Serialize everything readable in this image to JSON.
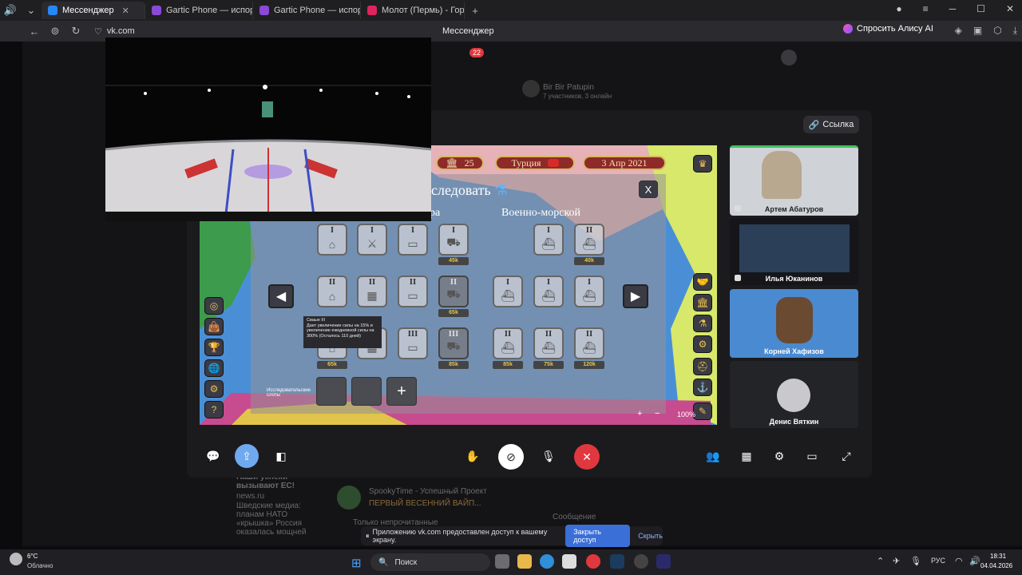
{
  "browser": {
    "tabs": [
      {
        "title": "Мессенджер",
        "active": true,
        "color": "#2787f5"
      },
      {
        "title": "Gartic Phone — испорчен",
        "active": false,
        "color": "#8a49d6"
      },
      {
        "title": "Gartic Phone — испорчен",
        "active": false,
        "color": "#8a49d6"
      },
      {
        "title": "Молот (Пермь) - Гор",
        "active": false,
        "color": "#e0245e"
      }
    ],
    "url": "vk.com",
    "page_title": "Мессенджер",
    "alice_label": "Спросить Алису AI"
  },
  "background": {
    "chat_name": "Bir Bir Patupin",
    "chat_meta": "7 участников, 3 онлайн",
    "badge_count": "22",
    "left_snippet_title": "Наши успехи вызывают ЕС!",
    "left_snippet_source": "news.ru",
    "left_snippet_text": "Шведские медиа: планам НАТО «крышка» Россия оказалась мощней",
    "list_item_title": "SpookyTime - Успешный Проект",
    "list_item_text": "ПЕРВЫЙ ВЕСЕННИЙ ВАЙП...",
    "only_important": "Только непрочитанные",
    "message_placeholder": "Сообщение"
  },
  "call": {
    "link_label": "Ссылка",
    "participants": [
      {
        "name": "Артем Абатуров"
      },
      {
        "name": "Илья Юканинов"
      },
      {
        "name": "Корней Хафизов"
      },
      {
        "name": "Денис Вяткин"
      }
    ]
  },
  "game": {
    "stat_value": "25",
    "country": "Турция",
    "date": "3 Апр 2021",
    "panel_title": "следовать",
    "category_left": "ра",
    "category_right": "Военно-морской",
    "tooltip_title": "Сваые III",
    "tooltip_text": "Дает увеличение силы на 15% и увеличение ежедневной силы на 300% (Осталось 110 дней)",
    "slots_label": "Исследовательские слоты",
    "zoom": "100%",
    "costs": {
      "land_top": "45k",
      "land_mid": "65k",
      "land_bottom_left": "65k",
      "land_bottom_right": "85k",
      "naval_top": "40k",
      "naval_b1": "85k",
      "naval_b2": "75k",
      "naval_b3": "120k"
    },
    "close_label": "X"
  },
  "share_bar": {
    "text": "Приложению vk.com предоставлен доступ к вашему экрану.",
    "stop_label": "Закрыть доступ",
    "hide_label": "Скрыть"
  },
  "taskbar": {
    "weather_temp": "6°C",
    "weather_desc": "Облачно",
    "search_label": "Поиск",
    "lang": "РУС",
    "time": "18:31",
    "date": "04.04.2026"
  },
  "colors": {
    "accent": "#3b6fd8",
    "hangup": "#e0383e",
    "game_banner": "#8e2a2a"
  }
}
